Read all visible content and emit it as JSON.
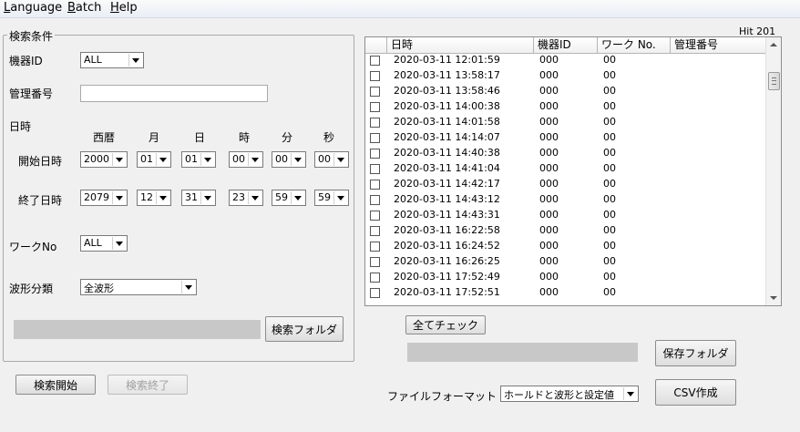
{
  "menu": {
    "language": {
      "first": "L",
      "rest": "anguage"
    },
    "batch": {
      "first": "B",
      "rest": "atch"
    },
    "help": {
      "first": "H",
      "rest": "elp"
    }
  },
  "search_group": {
    "title": "検索条件",
    "device_id_label": "機器ID",
    "device_id_value": "ALL",
    "mgmt_no_label": "管理番号",
    "mgmt_no_value": "",
    "datetime_label": "日時",
    "headers": {
      "year": "西暦",
      "month": "月",
      "day": "日",
      "hour": "時",
      "minute": "分",
      "second": "秒"
    },
    "start_label": "開始日時",
    "start": {
      "year": "2000",
      "month": "01",
      "day": "01",
      "hour": "00",
      "minute": "00",
      "second": "00"
    },
    "end_label": "終了日時",
    "end": {
      "year": "2079",
      "month": "12",
      "day": "31",
      "hour": "23",
      "minute": "59",
      "second": "59"
    },
    "work_no_label": "ワークNo",
    "work_no_value": "ALL",
    "waveform_label": "波形分類",
    "waveform_value": "全波形",
    "search_folder_button": "検索フォルダ"
  },
  "search_start_button": "検索開始",
  "search_end_button": "検索終了",
  "hit_count": "Hit 201",
  "list": {
    "columns": [
      "日時",
      "機器ID",
      "ワーク No.",
      "管理番号"
    ],
    "rows": [
      {
        "datetime": "2020-03-11 12:01:59",
        "device": "000",
        "work": "00"
      },
      {
        "datetime": "2020-03-11 13:58:17",
        "device": "000",
        "work": "00"
      },
      {
        "datetime": "2020-03-11 13:58:46",
        "device": "000",
        "work": "00"
      },
      {
        "datetime": "2020-03-11 14:00:38",
        "device": "000",
        "work": "00"
      },
      {
        "datetime": "2020-03-11 14:01:58",
        "device": "000",
        "work": "00"
      },
      {
        "datetime": "2020-03-11 14:14:07",
        "device": "000",
        "work": "00"
      },
      {
        "datetime": "2020-03-11 14:40:38",
        "device": "000",
        "work": "00"
      },
      {
        "datetime": "2020-03-11 14:41:04",
        "device": "000",
        "work": "00"
      },
      {
        "datetime": "2020-03-11 14:42:17",
        "device": "000",
        "work": "00"
      },
      {
        "datetime": "2020-03-11 14:43:12",
        "device": "000",
        "work": "00"
      },
      {
        "datetime": "2020-03-11 14:43:31",
        "device": "000",
        "work": "00"
      },
      {
        "datetime": "2020-03-11 16:22:58",
        "device": "000",
        "work": "00"
      },
      {
        "datetime": "2020-03-11 16:24:52",
        "device": "000",
        "work": "00"
      },
      {
        "datetime": "2020-03-11 16:26:25",
        "device": "000",
        "work": "00"
      },
      {
        "datetime": "2020-03-11 17:52:49",
        "device": "000",
        "work": "00"
      },
      {
        "datetime": "2020-03-11 17:52:51",
        "device": "000",
        "work": "00"
      }
    ]
  },
  "check_all_button": "全てチェック",
  "save_folder_button": "保存フォルダ",
  "file_format_label": "ファイルフォーマット",
  "file_format_value": "ホールドと波形と設定値",
  "csv_button": "CSV作成"
}
